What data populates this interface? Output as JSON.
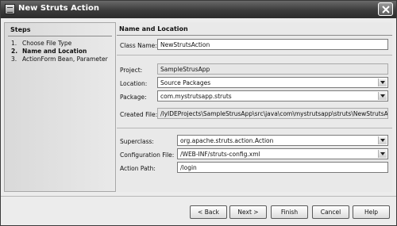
{
  "window": {
    "title": "New Struts Action"
  },
  "steps": {
    "heading": "Steps",
    "items": [
      {
        "num": "1.",
        "label": "Choose File Type"
      },
      {
        "num": "2.",
        "label": "Name and Location"
      },
      {
        "num": "3.",
        "label": "ActionForm Bean, Parameter"
      }
    ],
    "current_index": 1
  },
  "form": {
    "heading": "Name and Location",
    "class_name": {
      "label": "Class Name:",
      "value": "NewStrutsAction"
    },
    "project": {
      "label": "Project:",
      "value": "SampleStrusApp"
    },
    "location": {
      "label": "Location:",
      "value": "Source Packages"
    },
    "package": {
      "label": "Package:",
      "value": "com.mystrutsapp.struts"
    },
    "created_file": {
      "label": "Created File:",
      "value": "/lyIDEProjects\\SampleStrusApp\\src\\java\\com\\mystrutsapp\\struts\\NewStrutsAction."
    },
    "superclass": {
      "label": "Superclass:",
      "value": "org.apache.struts.action.Action"
    },
    "config_file": {
      "label": "Configuration File:",
      "value": "/WEB-INF/struts-config.xml"
    },
    "action_path": {
      "label": "Action Path:",
      "value": "/login"
    }
  },
  "buttons": {
    "back": "< Back",
    "next": "Next >",
    "finish": "Finish",
    "cancel": "Cancel",
    "help": "Help"
  }
}
